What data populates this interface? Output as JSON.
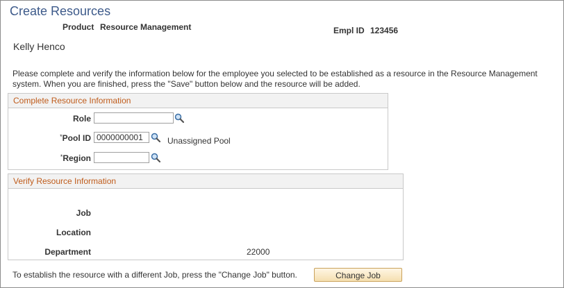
{
  "page": {
    "title": "Create Resources"
  },
  "header": {
    "product_label": "Product",
    "product_value": "Resource Management",
    "emplid_label": "Empl ID",
    "emplid_value": "123456",
    "employee_name": "Kelly Henco"
  },
  "instructions": "Please complete and verify the information below for the employee you selected to be established as a resource in the Resource Management system.  When you are finished, press the \"Save\" button below and the resource will be added.",
  "complete_section": {
    "title": "Complete Resource Information",
    "role": {
      "label": "Role",
      "value": ""
    },
    "pool_id": {
      "required_mark": "*",
      "label": "Pool ID",
      "value": "0000000001",
      "description": "Unassigned Pool"
    },
    "region": {
      "required_mark": "*",
      "label": "Region",
      "value": ""
    }
  },
  "verify_section": {
    "title": "Verify Resource Information",
    "job": {
      "label": "Job",
      "value": ""
    },
    "location": {
      "label": "Location",
      "value": ""
    },
    "department": {
      "label": "Department",
      "value": "22000"
    }
  },
  "footer": {
    "note": "To establish the resource with a different Job, press the \"Change Job\" button.",
    "change_job_label": "Change Job"
  },
  "icons": {
    "lookup": "magnifier-icon"
  },
  "colors": {
    "title": "#3d5a8a",
    "section_header": "#bf5b1a",
    "button_border": "#c9a15a"
  }
}
